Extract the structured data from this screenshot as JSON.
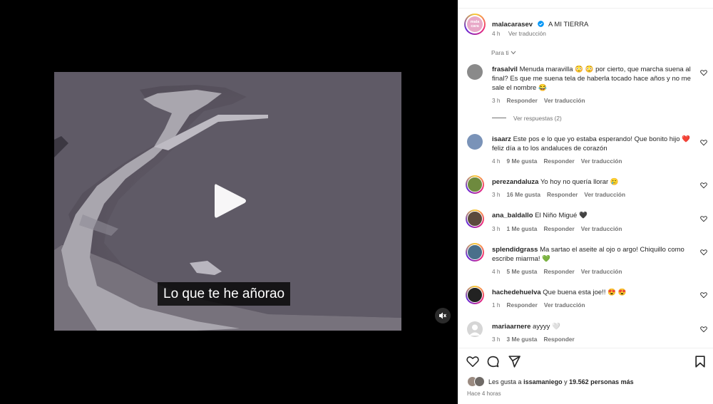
{
  "video": {
    "subtitle": "Lo que te he añorao"
  },
  "post": {
    "author": "malacarasev",
    "caption": "A MI TIERRA",
    "time": "4 h",
    "translate": "Ver traducción",
    "avatar_text": "mala cara"
  },
  "filter": {
    "label": "Para ti"
  },
  "comments": [
    {
      "user": "frasalvil",
      "text": "Menuda maravilla 😳 😳 por cierto, que marcha suena al final? Es que me suena tela de haberla tocado hace años y no me sale el nombre 😂",
      "time": "3 h",
      "likes": "",
      "reply": "Responder",
      "translate": "Ver traducción",
      "avatar_color": "#8a8a8a"
    },
    {
      "user": "isaarz",
      "text": "Este pos e lo que yo estaba esperando! Que bonito hijo ❤️ feliz día a to los andaluces de corazón",
      "time": "4 h",
      "likes": "9 Me gusta",
      "reply": "Responder",
      "translate": "Ver traducción",
      "avatar_color": "#7a93b8"
    },
    {
      "user": "perezandaluza",
      "text": "Yo hoy no quería llorar 🥲",
      "time": "3 h",
      "likes": "16 Me gusta",
      "reply": "Responder",
      "translate": "Ver traducción",
      "avatar_color": "#6e8a3e"
    },
    {
      "user": "ana_baldallo",
      "text": "El Niño Migué 🖤",
      "time": "3 h",
      "likes": "1 Me gusta",
      "reply": "Responder",
      "translate": "Ver traducción",
      "avatar_color": "#5b4a3c"
    },
    {
      "user": "splendidgrass",
      "text": "Ma sartao el aseite al ojo o argo! Chiquillo como escribe miarma! 💚",
      "time": "4 h",
      "likes": "5 Me gusta",
      "reply": "Responder",
      "translate": "Ver traducción",
      "avatar_color": "#4a6f8a"
    },
    {
      "user": "hachedehuelva",
      "text": "Que buena esta joe!! 😍 😍",
      "time": "1 h",
      "likes": "",
      "reply": "Responder",
      "translate": "Ver traducción",
      "avatar_color": "#222222"
    },
    {
      "user": "mariaarnere",
      "text": "ayyyy 🤍",
      "time": "3 h",
      "likes": "3 Me gusta",
      "reply": "Responder",
      "translate": "",
      "avatar_color": "#c9c9c9"
    }
  ],
  "replies": {
    "label": "Ver respuestas (2)"
  },
  "likes": {
    "prefix": "Les gusta a",
    "user": "issamaniego",
    "connector": "y",
    "count": "19.562 personas más"
  },
  "posted": "Hace 4 horas",
  "colors": {
    "verified": "#0095f6",
    "muted": "#737373",
    "text": "#262626"
  }
}
